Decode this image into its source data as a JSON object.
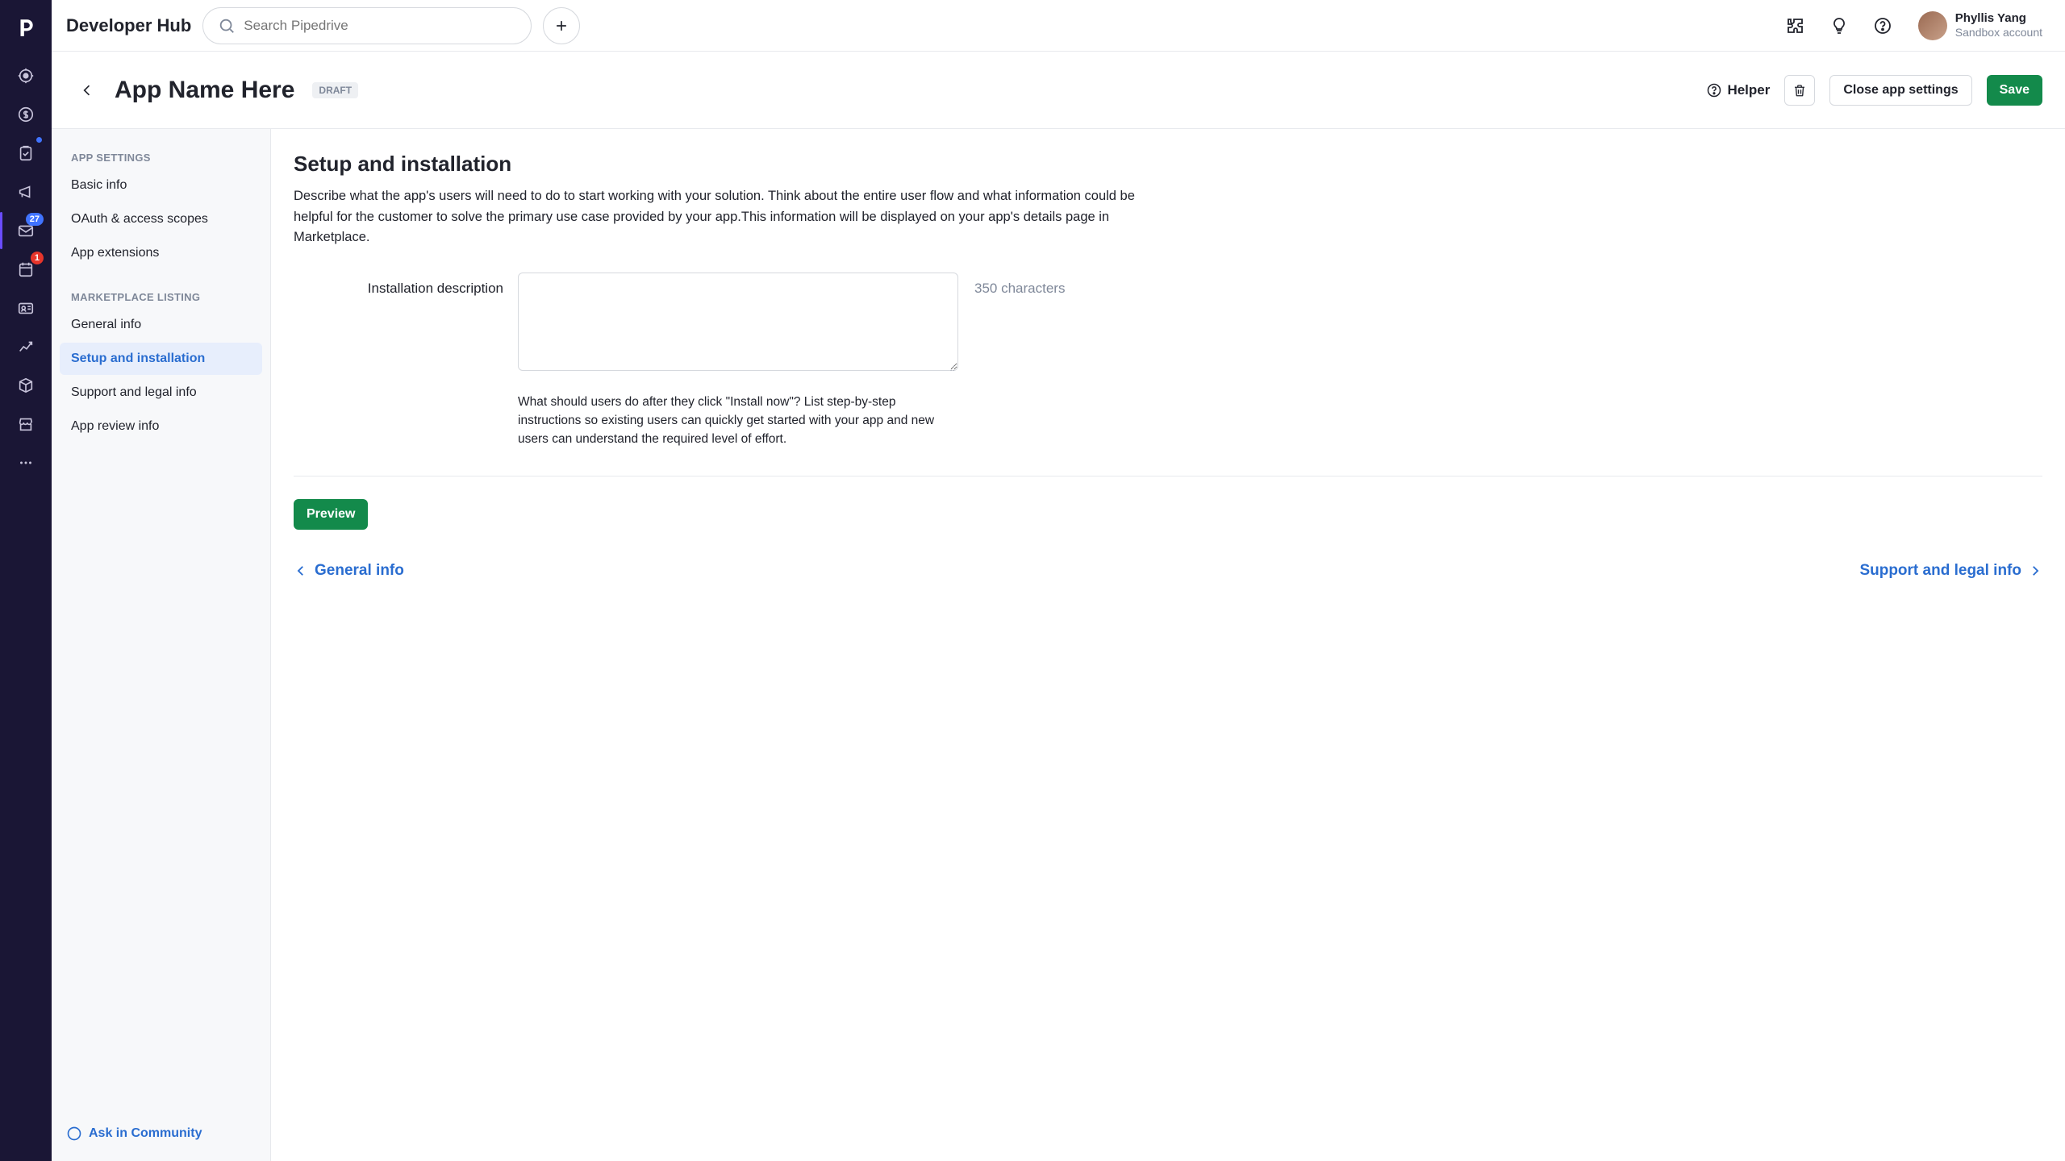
{
  "topbar": {
    "hub_title": "Developer Hub",
    "search_placeholder": "Search Pipedrive",
    "user_name": "Phyllis Yang",
    "user_account": "Sandbox account"
  },
  "vnav": {
    "mail_badge": "27",
    "cal_badge": "1"
  },
  "pagehdr": {
    "app_title": "App Name Here",
    "status_pill": "DRAFT",
    "helper_label": "Helper",
    "close_label": "Close app settings",
    "save_label": "Save"
  },
  "sidebar": {
    "section_app": "APP SETTINGS",
    "section_mkt": "MARKETPLACE LISTING",
    "items_app": [
      {
        "label": "Basic info"
      },
      {
        "label": "OAuth & access scopes"
      },
      {
        "label": "App extensions"
      }
    ],
    "items_mkt": [
      {
        "label": "General info"
      },
      {
        "label": "Setup and installation"
      },
      {
        "label": "Support and legal info"
      },
      {
        "label": "App review info"
      }
    ],
    "community_label": "Ask in Community"
  },
  "content": {
    "heading": "Setup and installation",
    "lead": "Describe what the app's users will need to do to start working with your solution. Think about the entire user flow and what information could be helpful for the customer to solve the primary use case provided by your app.This information will be displayed on your app's details page in Marketplace.",
    "field_label": "Installation description",
    "field_value": "",
    "char_count": "350 characters",
    "field_help": "What should users do after they click \"Install now\"? List step-by-step instructions so existing users can quickly get started with your app and new users can understand the required level of effort.",
    "preview_label": "Preview",
    "prev_link": "General info",
    "next_link": "Support and legal info"
  }
}
